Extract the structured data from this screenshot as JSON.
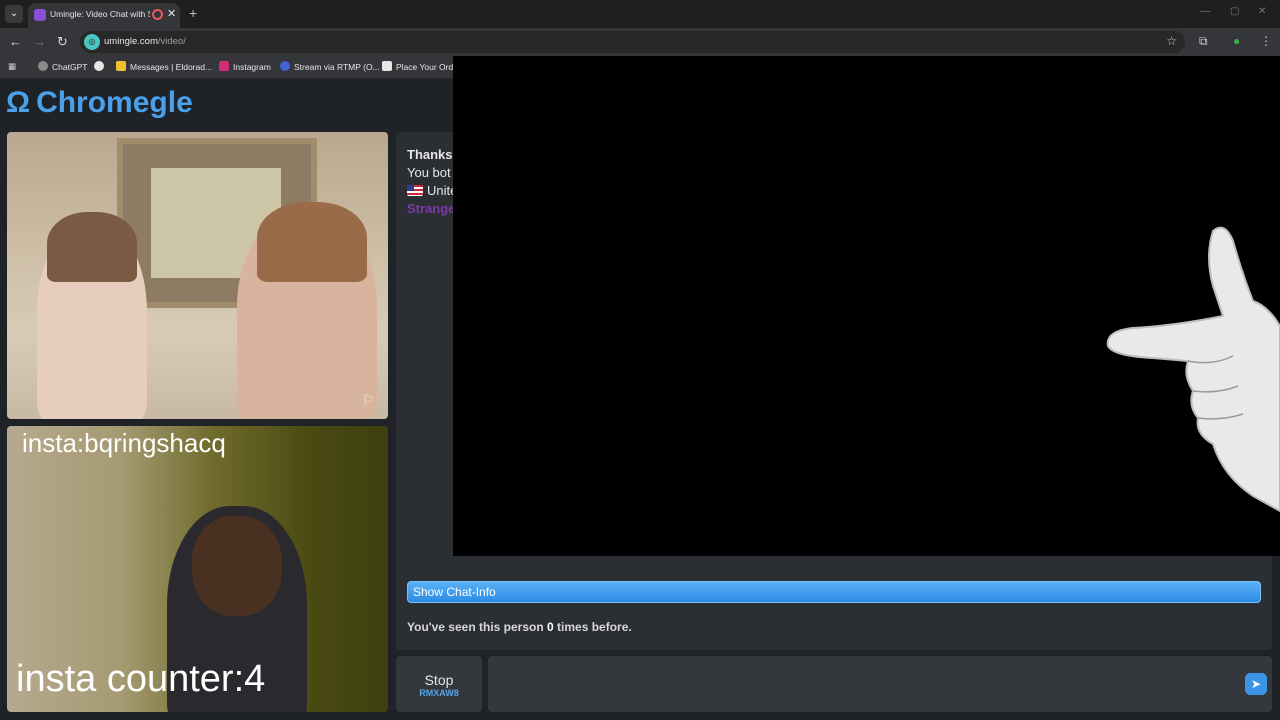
{
  "browser": {
    "tab_title": "Umingle: Video Chat with S",
    "url_host": "umingle.com",
    "url_path": "/video/",
    "bookmarks": [
      {
        "label": "ChatGPT",
        "color": "#8a8a8a"
      },
      {
        "label": "",
        "color": "#e6e6e6"
      },
      {
        "label": "Messages | Eldorad...",
        "color": "#f2c12e"
      },
      {
        "label": "Instagram",
        "color": "#d6297a"
      },
      {
        "label": "Stream via RTMP (O...",
        "color": "#4363d8"
      },
      {
        "label": "Place Your Orde",
        "color": "#e6e6e6"
      }
    ]
  },
  "site": {
    "logo_text": "Chromegle",
    "logo_symbol": "Ω"
  },
  "video_top": {},
  "video_bottom": {
    "overlay_top": "insta:bqringshacq",
    "overlay_bottom": "insta counter:4"
  },
  "chat": {
    "line1": "Thanks",
    "line2": "You bot",
    "line3": "Unite",
    "line4": "Strange",
    "show_chat_info": "Show Chat-Info",
    "seen_prefix": "You've seen this person ",
    "seen_count": "0",
    "seen_suffix": " times before."
  },
  "controls": {
    "stop_label": "Stop",
    "stop_code": "RMXAW8"
  },
  "colors": {
    "accent": "#4aa0ea",
    "stranger_label": "#7a3aa8"
  }
}
